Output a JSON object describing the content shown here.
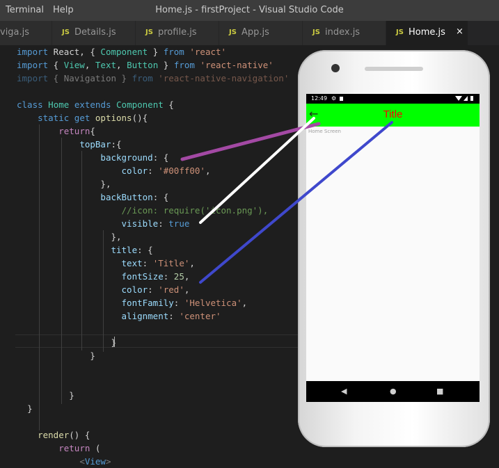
{
  "window": {
    "menu": [
      "Terminal",
      "Help"
    ],
    "title": "Home.js - firstProject - Visual Studio Code"
  },
  "tabs": [
    {
      "name": "viga.js",
      "js": ""
    },
    {
      "name": "Details.js",
      "js": "JS"
    },
    {
      "name": "profile.js",
      "js": "JS"
    },
    {
      "name": "App.js",
      "js": "JS"
    },
    {
      "name": "index.js",
      "js": "JS"
    },
    {
      "name": "Home.js",
      "js": "JS",
      "active": true
    }
  ],
  "close_glyph": "×",
  "code": [
    [
      [
        "import",
        "kw"
      ],
      [
        " React, { ",
        ""
      ],
      [
        "Component",
        "cls"
      ],
      [
        " } ",
        ""
      ],
      [
        "from",
        "kw"
      ],
      [
        " ",
        ""
      ],
      [
        "'react'",
        "str"
      ]
    ],
    [
      [
        "import",
        "kw"
      ],
      [
        " { ",
        ""
      ],
      [
        "View",
        "cls"
      ],
      [
        ", ",
        ""
      ],
      [
        "Text",
        "cls"
      ],
      [
        ", ",
        ""
      ],
      [
        "Button",
        "cls"
      ],
      [
        " } ",
        ""
      ],
      [
        "from",
        "kw"
      ],
      [
        " ",
        ""
      ],
      [
        "'react-native'",
        "str"
      ]
    ],
    [
      [
        "import",
        "kw dim"
      ],
      [
        " { Navigation } ",
        "dim"
      ],
      [
        "from",
        "kw dim"
      ],
      [
        " ",
        ""
      ],
      [
        "'react-native-navigation'",
        "str dim"
      ]
    ],
    [],
    [
      [
        "class",
        "kw"
      ],
      [
        " ",
        ""
      ],
      [
        "Home",
        "cls"
      ],
      [
        " ",
        ""
      ],
      [
        "extends",
        "kw"
      ],
      [
        " ",
        ""
      ],
      [
        "Component",
        "cls"
      ],
      [
        " {",
        ""
      ]
    ],
    [
      [
        "    ",
        ""
      ],
      [
        "static",
        "kw"
      ],
      [
        " ",
        ""
      ],
      [
        "get",
        "kw"
      ],
      [
        " ",
        ""
      ],
      [
        "options",
        "fn"
      ],
      [
        "(){",
        ""
      ]
    ],
    [
      [
        "        ",
        ""
      ],
      [
        "return",
        "flow"
      ],
      [
        "{",
        ""
      ]
    ],
    [
      [
        "            ",
        ""
      ],
      [
        "topBar",
        "prop"
      ],
      [
        ":{",
        ""
      ]
    ],
    [
      [
        "                ",
        ""
      ],
      [
        "background",
        "prop"
      ],
      [
        ": {",
        ""
      ]
    ],
    [
      [
        "                    ",
        ""
      ],
      [
        "color",
        "prop"
      ],
      [
        ": ",
        ""
      ],
      [
        "'#00ff00'",
        "str"
      ],
      [
        ",",
        ""
      ]
    ],
    [
      [
        "                ",
        ""
      ],
      [
        "},",
        ""
      ]
    ],
    [
      [
        "                ",
        ""
      ],
      [
        "backButton",
        "prop"
      ],
      [
        ": {",
        ""
      ]
    ],
    [
      [
        "                    ",
        ""
      ],
      [
        "//icon: require('icon.png'),",
        "com"
      ]
    ],
    [
      [
        "                    ",
        ""
      ],
      [
        "visible",
        "prop"
      ],
      [
        ": ",
        ""
      ],
      [
        "true",
        "kw"
      ]
    ],
    [
      [
        "                  ",
        ""
      ],
      [
        "},",
        ""
      ]
    ],
    [
      [
        "                  ",
        ""
      ],
      [
        "title",
        "prop"
      ],
      [
        ": {",
        ""
      ]
    ],
    [
      [
        "                    ",
        ""
      ],
      [
        "text",
        "prop"
      ],
      [
        ": ",
        ""
      ],
      [
        "'Title'",
        "str"
      ],
      [
        ",",
        ""
      ]
    ],
    [
      [
        "                    ",
        ""
      ],
      [
        "fontSize",
        "prop"
      ],
      [
        ": ",
        ""
      ],
      [
        "25",
        "num"
      ],
      [
        ",",
        ""
      ]
    ],
    [
      [
        "                    ",
        ""
      ],
      [
        "color",
        "prop"
      ],
      [
        ": ",
        ""
      ],
      [
        "'red'",
        "str"
      ],
      [
        ",",
        ""
      ]
    ],
    [
      [
        "                    ",
        ""
      ],
      [
        "fontFamily",
        "prop"
      ],
      [
        ": ",
        ""
      ],
      [
        "'Helvetica'",
        "str"
      ],
      [
        ",",
        ""
      ]
    ],
    [
      [
        "                    ",
        ""
      ],
      [
        "alignment",
        "prop"
      ],
      [
        ": ",
        ""
      ],
      [
        "'center'",
        "str"
      ]
    ],
    [],
    [
      [
        "                  ",
        ""
      ],
      [
        "}",
        ""
      ]
    ],
    [
      [
        "              ",
        ""
      ],
      [
        "}",
        ""
      ]
    ],
    [],
    [],
    [
      [
        "          ",
        ""
      ],
      [
        "}",
        ""
      ]
    ],
    [
      [
        "  ",
        ""
      ],
      [
        "}",
        ""
      ]
    ],
    [],
    [
      [
        "    ",
        ""
      ],
      [
        "render",
        "fn"
      ],
      [
        "() {",
        ""
      ]
    ],
    [
      [
        "        ",
        ""
      ],
      [
        "return",
        "flow"
      ],
      [
        " (",
        ""
      ]
    ],
    [
      [
        "            ",
        ""
      ],
      [
        "<",
        "dim"
      ],
      [
        "View",
        "tag"
      ],
      [
        ">",
        "dim"
      ]
    ]
  ],
  "phone": {
    "status_time": "12:49",
    "back_arrow": "←",
    "title": "Title",
    "title_color": "#ff0000",
    "topbar_color": "#00ff00",
    "body_text": "Home Screen",
    "nav": [
      "◀",
      "●",
      "■"
    ]
  },
  "annotation_colors": [
    "#a349a4",
    "#ffffff",
    "#3f48cc"
  ]
}
